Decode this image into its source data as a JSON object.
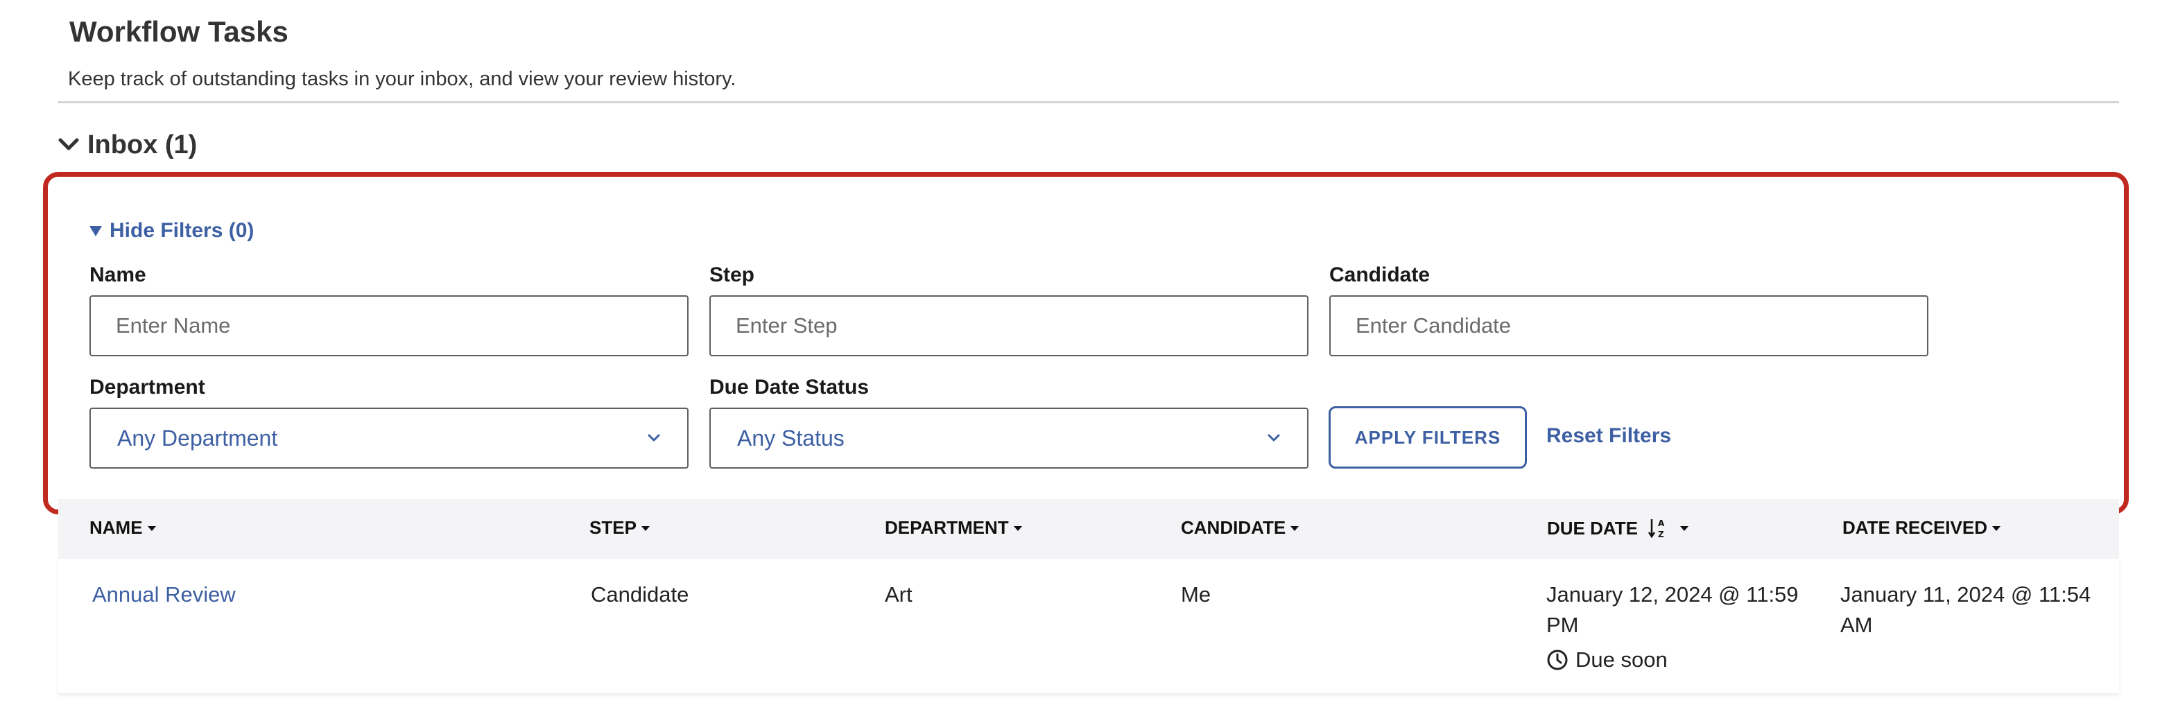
{
  "page": {
    "title": "Workflow Tasks",
    "subtitle": "Keep track of outstanding tasks in your inbox, and view your review history."
  },
  "inbox": {
    "label": "Inbox (1)",
    "icon": "chevron-down-icon"
  },
  "filters": {
    "toggle_label": "Hide Filters (0)",
    "name": {
      "label": "Name",
      "placeholder": "Enter Name",
      "value": ""
    },
    "step": {
      "label": "Step",
      "placeholder": "Enter Step",
      "value": ""
    },
    "candidate": {
      "label": "Candidate",
      "placeholder": "Enter Candidate",
      "value": ""
    },
    "department": {
      "label": "Department",
      "selected": "Any Department"
    },
    "due_date_status": {
      "label": "Due Date Status",
      "selected": "Any Status"
    },
    "apply_label": "APPLY FILTERS",
    "reset_label": "Reset Filters"
  },
  "table": {
    "columns": {
      "name": "NAME",
      "step": "STEP",
      "department": "DEPARTMENT",
      "candidate": "CANDIDATE",
      "due_date": "DUE DATE",
      "date_received": "DATE RECEIVED"
    },
    "rows": [
      {
        "name": "Annual Review",
        "step": "Candidate",
        "department": "Art",
        "candidate": "Me",
        "due_date": "January 12, 2024 @ 11:59 PM",
        "due_status": "Due soon",
        "date_received": "January 11, 2024 @ 11:54 AM"
      }
    ]
  },
  "colors": {
    "accent": "#3d5fa3",
    "highlight": "#c0291f",
    "header_bg": "#f4f4f6"
  }
}
